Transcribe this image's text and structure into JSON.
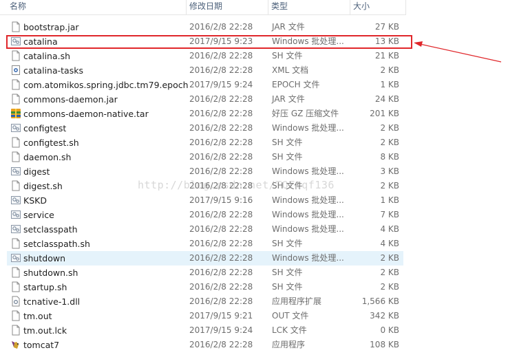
{
  "header": {
    "name": "名称",
    "date": "修改日期",
    "type": "类型",
    "size": "大小"
  },
  "watermark": "http://blog.csdn.net/TQFtqf136",
  "files": [
    {
      "name": "bootstrap.jar",
      "date": "2016/2/8 22:28",
      "type": "JAR 文件",
      "size": "27 KB",
      "icon": "file-icon"
    },
    {
      "name": "catalina",
      "date": "2017/9/15 9:23",
      "type": "Windows 批处理...",
      "size": "13 KB",
      "icon": "batch-file-icon"
    },
    {
      "name": "catalina.sh",
      "date": "2016/2/8 22:28",
      "type": "SH 文件",
      "size": "21 KB",
      "icon": "file-icon"
    },
    {
      "name": "catalina-tasks",
      "date": "2016/2/8 22:28",
      "type": "XML 文档",
      "size": "2 KB",
      "icon": "xml-file-icon"
    },
    {
      "name": "com.atomikos.spring.jdbc.tm79.epoch",
      "date": "2017/9/15 9:24",
      "type": "EPOCH 文件",
      "size": "1 KB",
      "icon": "file-icon"
    },
    {
      "name": "commons-daemon.jar",
      "date": "2016/2/8 22:28",
      "type": "JAR 文件",
      "size": "24 KB",
      "icon": "file-icon"
    },
    {
      "name": "commons-daemon-native.tar",
      "date": "2016/2/8 22:28",
      "type": "好压 GZ 压缩文件",
      "size": "201 KB",
      "icon": "archive-icon"
    },
    {
      "name": "configtest",
      "date": "2016/2/8 22:28",
      "type": "Windows 批处理...",
      "size": "2 KB",
      "icon": "batch-file-icon"
    },
    {
      "name": "configtest.sh",
      "date": "2016/2/8 22:28",
      "type": "SH 文件",
      "size": "2 KB",
      "icon": "file-icon"
    },
    {
      "name": "daemon.sh",
      "date": "2016/2/8 22:28",
      "type": "SH 文件",
      "size": "8 KB",
      "icon": "file-icon"
    },
    {
      "name": "digest",
      "date": "2016/2/8 22:28",
      "type": "Windows 批处理...",
      "size": "3 KB",
      "icon": "batch-file-icon"
    },
    {
      "name": "digest.sh",
      "date": "2016/2/8 22:28",
      "type": "SH 文件",
      "size": "2 KB",
      "icon": "file-icon"
    },
    {
      "name": "KSKD",
      "date": "2017/9/15 9:16",
      "type": "Windows 批处理...",
      "size": "1 KB",
      "icon": "batch-file-icon"
    },
    {
      "name": "service",
      "date": "2016/2/8 22:28",
      "type": "Windows 批处理...",
      "size": "7 KB",
      "icon": "batch-file-icon"
    },
    {
      "name": "setclasspath",
      "date": "2016/2/8 22:28",
      "type": "Windows 批处理...",
      "size": "4 KB",
      "icon": "batch-file-icon"
    },
    {
      "name": "setclasspath.sh",
      "date": "2016/2/8 22:28",
      "type": "SH 文件",
      "size": "4 KB",
      "icon": "file-icon"
    },
    {
      "name": "shutdown",
      "date": "2016/2/8 22:28",
      "type": "Windows 批处理...",
      "size": "2 KB",
      "icon": "batch-file-icon",
      "highlighted": true
    },
    {
      "name": "shutdown.sh",
      "date": "2016/2/8 22:28",
      "type": "SH 文件",
      "size": "2 KB",
      "icon": "file-icon"
    },
    {
      "name": "startup.sh",
      "date": "2016/2/8 22:28",
      "type": "SH 文件",
      "size": "2 KB",
      "icon": "file-icon"
    },
    {
      "name": "tcnative-1.dll",
      "date": "2016/2/8 22:28",
      "type": "应用程序扩展",
      "size": "1,566 KB",
      "icon": "dll-file-icon"
    },
    {
      "name": "tm.out",
      "date": "2017/9/15 9:21",
      "type": "OUT 文件",
      "size": "342 KB",
      "icon": "file-icon"
    },
    {
      "name": "tm.out.lck",
      "date": "2017/9/15 9:24",
      "type": "LCK 文件",
      "size": "0 KB",
      "icon": "file-icon"
    },
    {
      "name": "tomcat7",
      "date": "2016/2/8 22:28",
      "type": "应用程序",
      "size": "108 KB",
      "icon": "tomcat-app-icon"
    }
  ],
  "colors": {
    "annotation": "#e0262a",
    "hover_row": "#e5f3fb",
    "header_text": "#4c607a"
  }
}
